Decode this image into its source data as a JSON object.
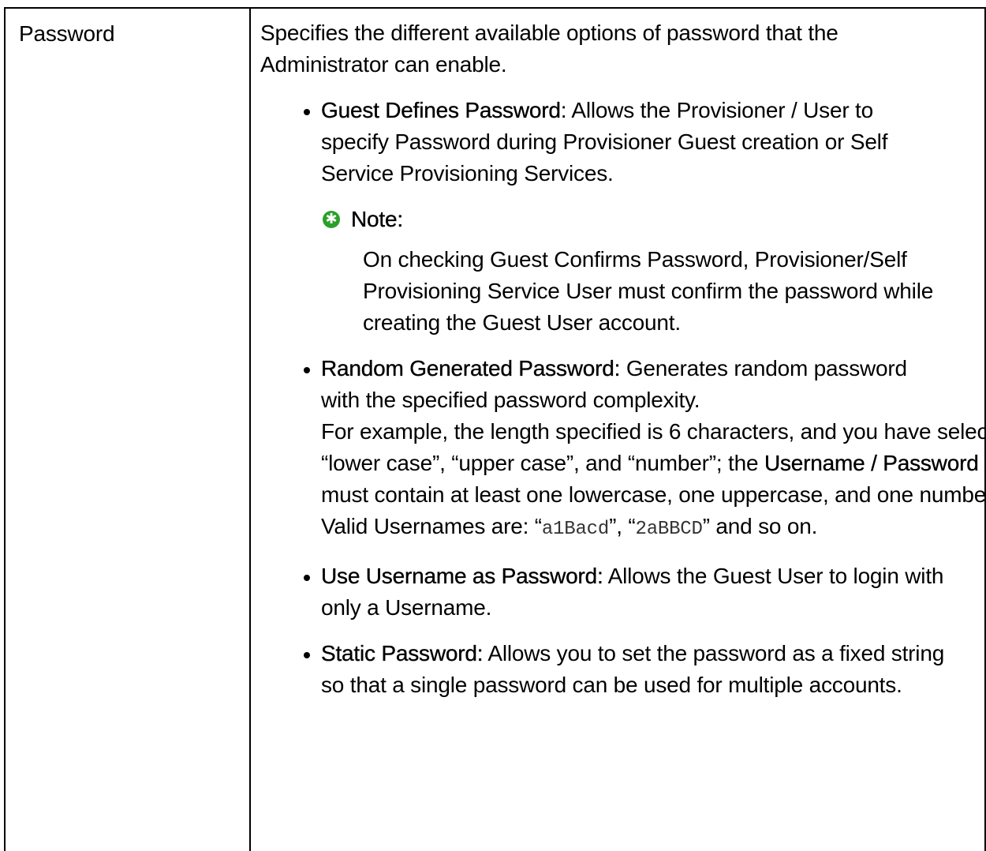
{
  "row": {
    "term": "Password",
    "intro": "Specifies the different available options of password that the Administrator can enable.",
    "options": [
      {
        "name": "Guest Defines Password",
        "separator": ": ",
        "text": "Allows the Provisioner / User to specify Password during Provisioner Guest creation or Self Service Provisioning Services."
      },
      {
        "name": "Random Generated Password:",
        "separator": " ",
        "text": "Generates random password with the specified password complexity."
      },
      {
        "name": "Use Username as Password:",
        "separator": " ",
        "text": "Allows the Guest User to login with only a Username."
      },
      {
        "name": "Static Password:",
        "separator": " ",
        "text": "Allows you to set the password as a fixed string so that a single password can be used for multiple accounts."
      }
    ],
    "note": {
      "icon": "note-star-icon",
      "icon_color": "#2aa02a",
      "label": "Note:",
      "text": "On checking Guest Confirms Password, Provisioner/Self Provisioning Service User must confirm the password while creating the Guest User account."
    },
    "example": {
      "before": "For example, the length specified is 6 characters, and you have selected “lower case”, “upper case”, and “number”; the ",
      "bold": "Username / Password",
      "after": " must contain at least one lowercase, one uppercase, and one number. Valid Usernames are: “",
      "code1": "a1Bacd",
      "mid": "”, “",
      "code2": "2aBBCD",
      "end": "” and so on."
    }
  }
}
